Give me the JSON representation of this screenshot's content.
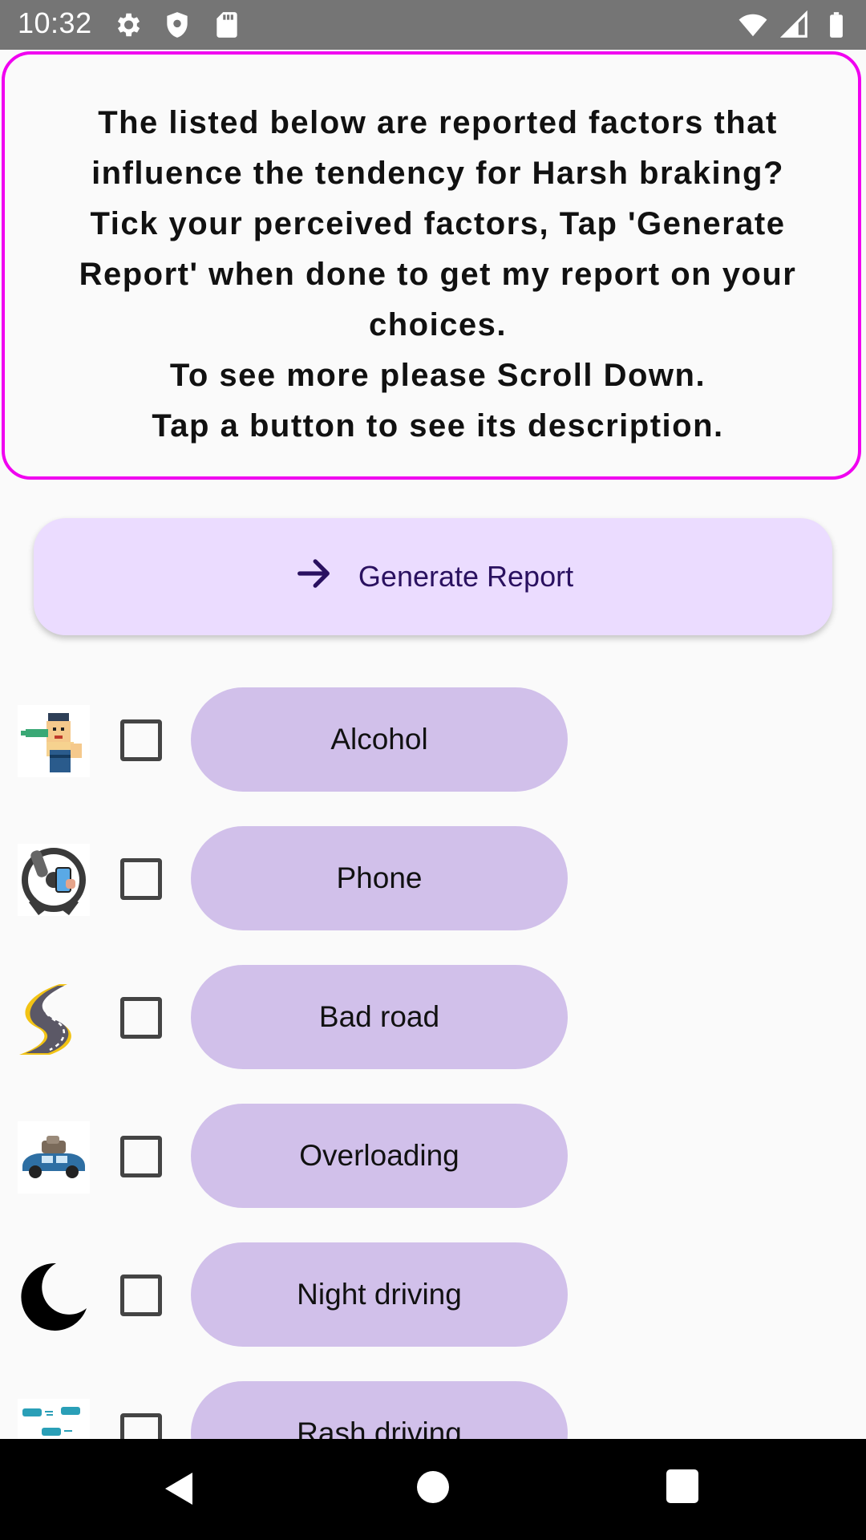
{
  "status_bar": {
    "time": "10:32",
    "left_icons": [
      "settings-icon",
      "shield-icon",
      "sd-card-icon"
    ],
    "right_icons": [
      "wifi-icon",
      "signal-icon",
      "battery-icon"
    ]
  },
  "instruction": {
    "text": "The listed below are reported factors that\ninfluence the tendency for Harsh braking?\nTick your perceived factors, Tap 'Generate\nReport' when done to get my report on your\nchoices.\nTo see more please Scroll Down.\nTap a button to see its description."
  },
  "generate_button": {
    "label": "Generate Report",
    "icon": "arrow-right-icon"
  },
  "factors": [
    {
      "label": "Alcohol",
      "icon": "drinking-man-icon",
      "checked": false
    },
    {
      "label": "Phone",
      "icon": "phone-while-driving-icon",
      "checked": false
    },
    {
      "label": "Bad road",
      "icon": "winding-road-icon",
      "checked": false
    },
    {
      "label": "Overloading",
      "icon": "overloaded-car-icon",
      "checked": false
    },
    {
      "label": "Night driving",
      "icon": "moon-icon",
      "checked": false
    },
    {
      "label": "Rash driving",
      "icon": "rash-driving-cars-icon",
      "checked": false
    }
  ],
  "colors": {
    "border_accent": "#f000f0",
    "generate_bg": "#ebdcff",
    "factor_bg": "#d1c0ea",
    "status_bar": "#757575"
  },
  "nav_bar": {
    "buttons": [
      "back-icon",
      "home-icon",
      "recents-icon"
    ]
  }
}
